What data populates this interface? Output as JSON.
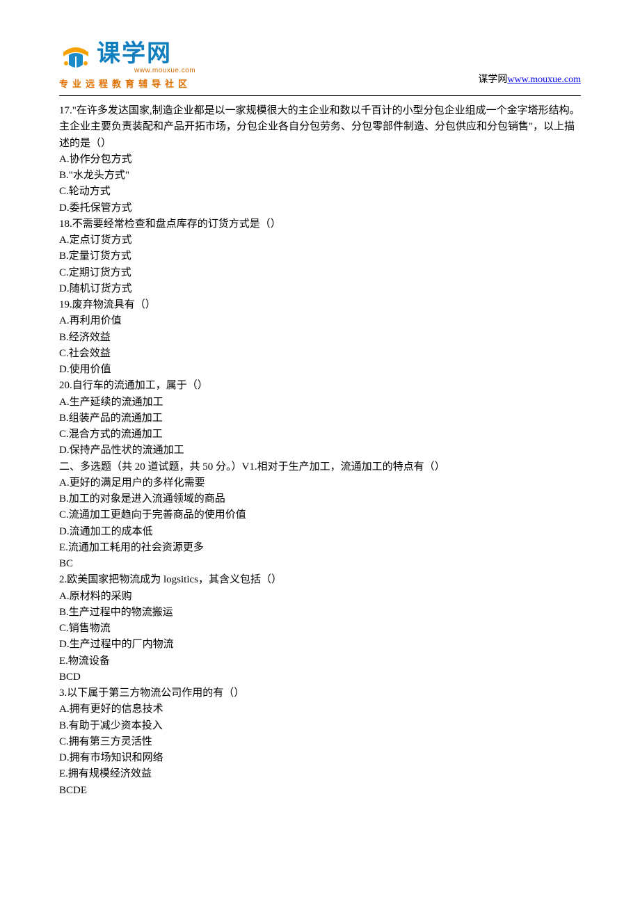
{
  "header": {
    "logo_text": "课学网",
    "logo_sub": "www.mouxue.com",
    "tagline": "专业远程教育辅导社区",
    "site_label": "谋学网",
    "site_url": "www.mouxue.com"
  },
  "lines": [
    "17.\"在许多发达国家,制造企业都是以一家规模很大的主企业和数以千百计的小型分包企业组成一个金字塔形结构。主企业主要负责装配和产品开拓市场，分包企业各自分包劳务、分包零部件制造、分包供应和分包销售\"，以上描述的是（）",
    "A.协作分包方式",
    "B.\"水龙头方式\"",
    "C.轮动方式",
    "D.委托保管方式",
    "18.不需要经常检查和盘点库存的订货方式是（）",
    "A.定点订货方式",
    "B.定量订货方式",
    "C.定期订货方式",
    "D.随机订货方式",
    "19.废弃物流具有（）",
    "A.再利用价值",
    "B.经济效益",
    "C.社会效益",
    "D.使用价值",
    "20.自行车的流通加工，属于（）",
    "A.生产延续的流通加工",
    "B.组装产品的流通加工",
    "C.混合方式的流通加工",
    "D.保持产品性状的流通加工",
    "二、多选题（共 20 道试题，共 50 分。）V1.相对于生产加工，流通加工的特点有（）",
    "A.更好的满足用户的多样化需要",
    "B.加工的对象是进入流通领域的商品",
    "C.流通加工更趋向于完善商品的使用价值",
    "D.流通加工的成本低",
    "E.流通加工耗用的社会资源更多",
    "BC",
    "2.欧美国家把物流成为 logsitics，其含义包括（）",
    "A.原材料的采购",
    "B.生产过程中的物流搬运",
    "C.销售物流",
    "D.生产过程中的厂内物流",
    "E.物流设备",
    "BCD",
    "3.以下属于第三方物流公司作用的有（）",
    "A.拥有更好的信息技术",
    "B.有助于减少资本投入",
    "C.拥有第三方灵活性",
    "D.拥有市场知识和网络",
    "E.拥有规模经济效益",
    "BCDE"
  ]
}
